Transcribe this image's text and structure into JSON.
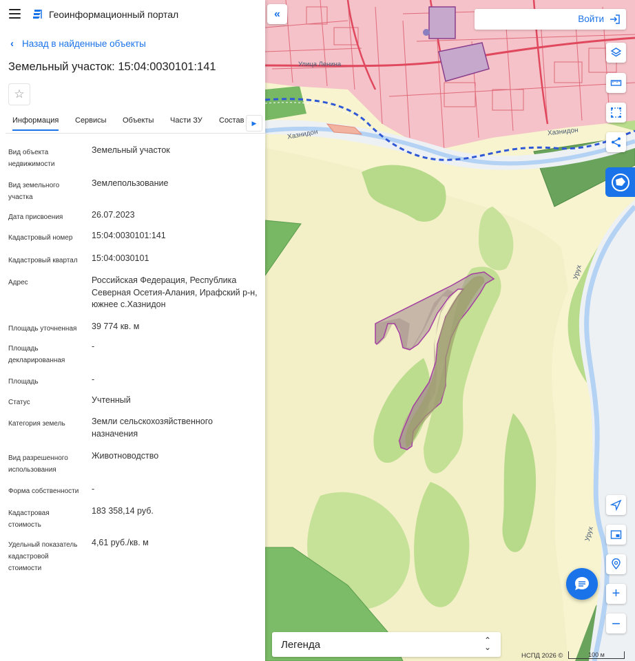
{
  "app": {
    "title": "Геоинформационный портал"
  },
  "nav": {
    "back_label": "Назад в найденные объекты"
  },
  "object": {
    "title": "Земельный участок: 15:04:0030101:141"
  },
  "tabs": [
    {
      "label": "Информация",
      "active": true
    },
    {
      "label": "Сервисы"
    },
    {
      "label": "Объекты"
    },
    {
      "label": "Части ЗУ"
    },
    {
      "label": "Состав"
    }
  ],
  "fields": [
    {
      "label": "Вид объекта недвижимости",
      "value": "Земельный участок"
    },
    {
      "label": "Вид земельного участка",
      "value": "Землепользование"
    },
    {
      "label": "Дата присвоения",
      "value": "26.07.2023"
    },
    {
      "label": "Кадастровый номер",
      "value": "15:04:0030101:141"
    },
    {
      "label": "Кадастровый квартал",
      "value": "15:04:0030101"
    },
    {
      "label": "Адрес",
      "value": "Российская Федерация, Республика Северная Осетия-Алания, Ирафский р-н, южнее с.Хазнидон"
    },
    {
      "label": "Площадь уточненная",
      "value": "39 774 кв. м"
    },
    {
      "label": "Площадь декларированная",
      "value": "-"
    },
    {
      "label": "Площадь",
      "value": "-"
    },
    {
      "label": "Статус",
      "value": "Учтенный"
    },
    {
      "label": "Категория земель",
      "value": "Земли сельскохозяйственного назначения"
    },
    {
      "label": "Вид разрешенного использования",
      "value": "Животноводство"
    },
    {
      "label": "Форма собственности",
      "value": "-"
    },
    {
      "label": "Кадастровая стоимость",
      "value": "183 358,14 руб."
    },
    {
      "label": "Удельный показатель кадастровой стоимости",
      "value": "4,61 руб./кв. м"
    }
  ],
  "map": {
    "login_label": "Войти",
    "legend_label": "Легенда",
    "attribution": "НСПД 2026 ©",
    "scale_label": "100 м",
    "labels": {
      "street": "Улица Ленина",
      "river_1": "Хазнидон",
      "river_2": "Хазнидон",
      "river_3": "Урух",
      "river_4": "Урух"
    }
  },
  "colors": {
    "accent": "#1a73e8",
    "parcel_fill": "#a08890",
    "parcel_stroke": "#a43ea0",
    "urban_fill": "#f4c2c8",
    "forest": "#8cc66a",
    "meadow": "#f7f4cf"
  }
}
